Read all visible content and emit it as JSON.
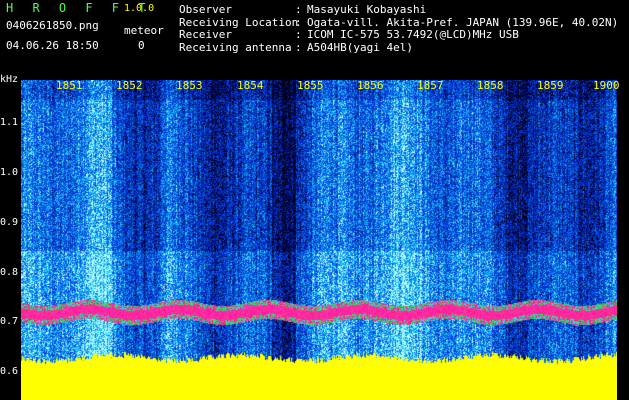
{
  "app": {
    "title": "H R O F F T",
    "version": "1.0.0"
  },
  "file": {
    "name": "0406261850.png",
    "datetime": "04.06.26 18:50"
  },
  "meteor": {
    "label": "meteor",
    "count": "0"
  },
  "info": [
    {
      "key": "Observer",
      "value": "Masayuki Kobayashi"
    },
    {
      "key": "Receiving Location",
      "value": "Ogata-vill. Akita-Pref. JAPAN (139.96E, 40.02N)"
    },
    {
      "key": "Receiver",
      "value": "ICOM IC-575 53.7492(@LCD)MHz USB"
    },
    {
      "key": "Receiving antenna",
      "value": "A504HB(yagi 4el)"
    }
  ],
  "axis": {
    "unit": "kHz",
    "time_ticks": [
      "1851",
      "1852",
      "1853",
      "1854",
      "1855",
      "1856",
      "1857",
      "1858",
      "1859",
      "1900"
    ],
    "freq_ticks": [
      "1.1",
      "1.0",
      "0.9",
      "0.8",
      "0.7",
      "0.6"
    ]
  },
  "colors": {
    "noise_low": "#000040",
    "noise_mid": "#1c3ed8",
    "noise_high": "#3cc8ff",
    "band_edge": "#20e060",
    "band_core": "#ff2090",
    "base": "#ffff00",
    "label": "#ffff00"
  }
}
